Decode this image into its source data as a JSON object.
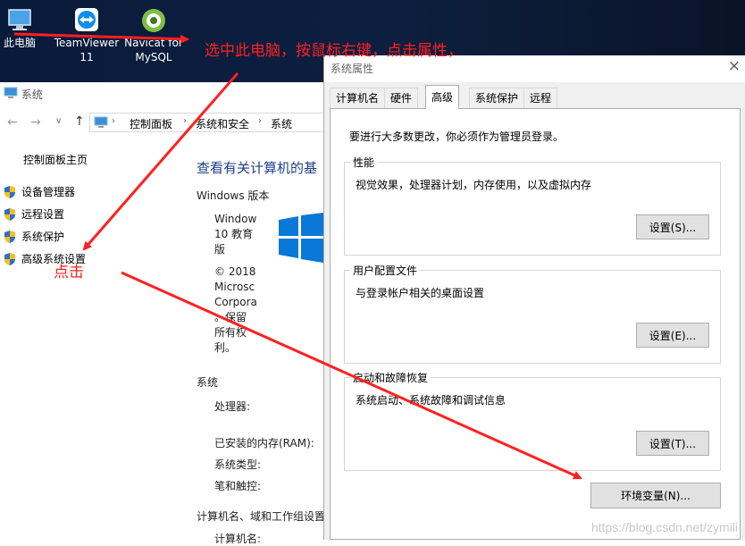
{
  "desktop": {
    "icons": [
      {
        "label": "此电脑"
      },
      {
        "label": "TeamViewer 11"
      },
      {
        "label": "Navicat for MySQL"
      }
    ]
  },
  "system_window": {
    "title": "系统",
    "breadcrumb": [
      "控制面板",
      "系统和安全",
      "系统"
    ],
    "sidebar": {
      "home": "控制面板主页",
      "items": [
        "设备管理器",
        "远程设置",
        "系统保护",
        "高级系统设置"
      ]
    },
    "main": {
      "heading": "查看有关计算机的基",
      "edition_section": "Windows 版本",
      "edition_lines": [
        "Window",
        "10 教育",
        "版"
      ],
      "copyright_lines": [
        "© 2018",
        "Microsc",
        "Corpora",
        "。保留",
        "所有权",
        "利。"
      ],
      "system_section": "系统",
      "processor_label": "处理器:",
      "ram_label": "已安装的内存(RAM):",
      "type_label": "系统类型:",
      "pen_label": "笔和触控:",
      "name_section": "计算机名、域和工作组设置",
      "computer_name_label": "计算机名:"
    }
  },
  "dialog": {
    "title": "系统属性",
    "close": "×",
    "tabs": [
      "计算机名",
      "硬件",
      "高级",
      "系统保护",
      "远程"
    ],
    "active_tab": 2,
    "admin_note": "要进行大多数更改，你必须作为管理员登录。",
    "groups": [
      {
        "title": "性能",
        "desc": "视觉效果，处理器计划，内存使用，以及虚拟内存",
        "button": "设置(S)..."
      },
      {
        "title": "用户配置文件",
        "desc": "与登录帐户相关的桌面设置",
        "button": "设置(E)..."
      },
      {
        "title": "启动和故障恢复",
        "desc": "系统启动、系统故障和调试信息",
        "button": "设置(T)..."
      }
    ],
    "env_button": "环境变量(N)..."
  },
  "annotations": {
    "step1": "选中此电脑，按鼠标右键，点击属性，",
    "step2": "点击"
  },
  "watermark": "https://blog.csdn.net/zymili",
  "colors": {
    "annotation": "#ff2020",
    "desktop_bg": "#0b1730",
    "button_bg": "#e1e1e1"
  }
}
